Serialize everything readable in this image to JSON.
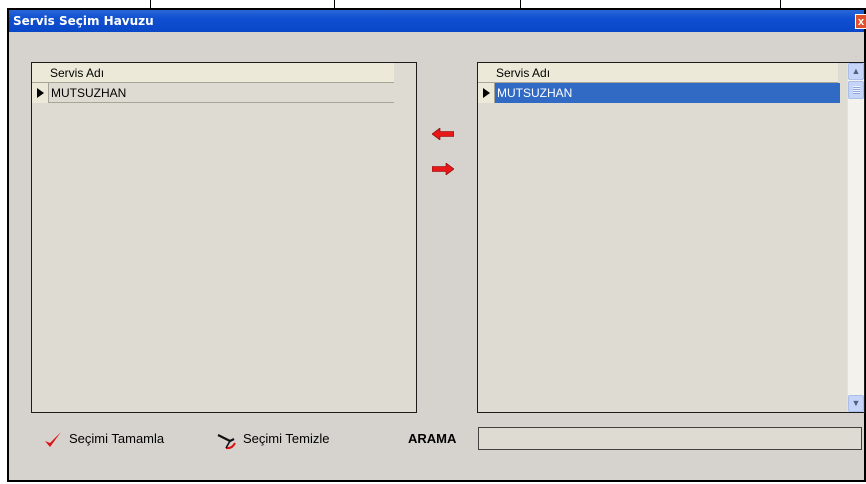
{
  "window": {
    "title": "Servis Seçim Havuzu",
    "close_glyph": "x"
  },
  "left_list": {
    "column_header": "Servis Adı",
    "rows": [
      "MUTSUZHAN"
    ]
  },
  "right_list": {
    "column_header": "Servis Adı",
    "rows": [
      "MUTSUZHAN"
    ],
    "selected_row_color": "#316ac5"
  },
  "transfer": {
    "move_left_icon": "red-arrow-left-icon",
    "move_right_icon": "red-arrow-right-icon",
    "arrow_color": "#e81818"
  },
  "footer": {
    "complete_label": "Seçimi Tamamla",
    "clear_label": "Seçimi Temizle",
    "search_label": "ARAMA",
    "search_value": ""
  },
  "colors": {
    "title_bar": "#0848c8",
    "dialog_bg": "#d6d3ce"
  }
}
